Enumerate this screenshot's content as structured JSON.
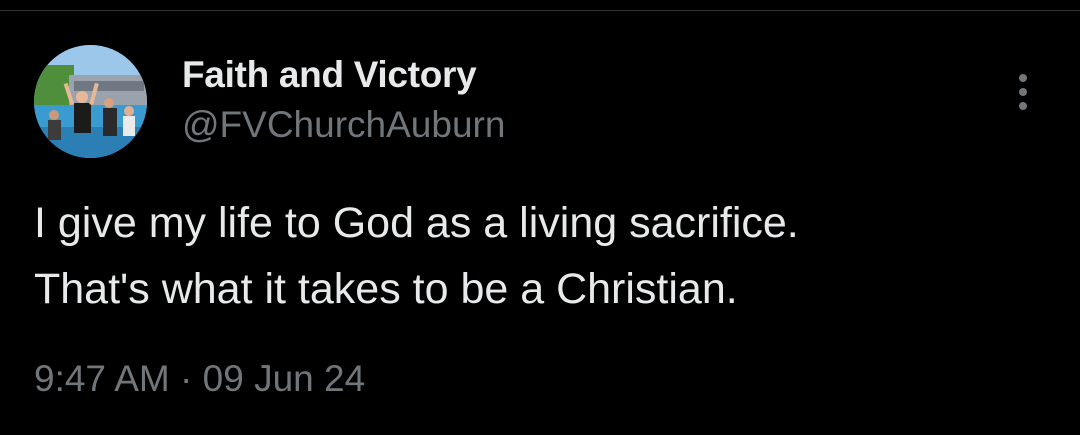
{
  "author": {
    "display_name": "Faith and Victory",
    "handle": "@FVChurchAuburn",
    "avatar_icon": "profile-photo"
  },
  "menu": {
    "icon": "more-options-icon"
  },
  "tweet": {
    "lines": [
      "I give my life to God as a living sacrifice.",
      "That's what it takes to be a Christian."
    ]
  },
  "meta": {
    "time": "9:47 AM",
    "separator": "·",
    "date": "09 Jun 24"
  },
  "colors": {
    "background": "#000000",
    "primary_text": "#e7e9ea",
    "secondary_text": "#71767b",
    "divider": "#2f3336"
  }
}
